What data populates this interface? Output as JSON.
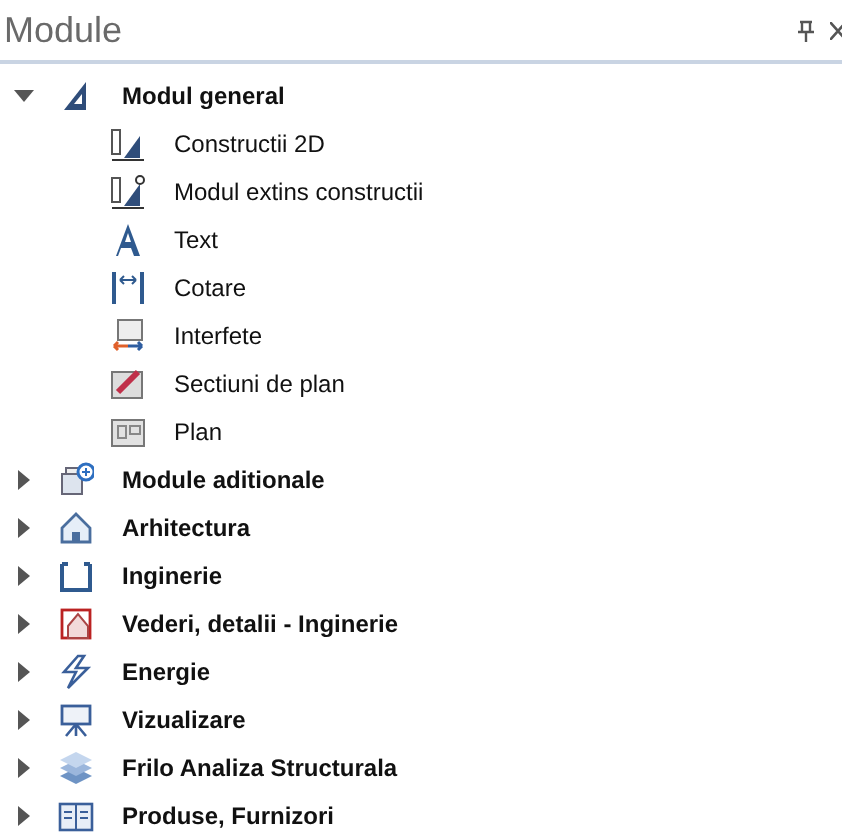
{
  "panel": {
    "title": "Module"
  },
  "tree": [
    {
      "label": "Modul general",
      "expanded": true,
      "children": [
        {
          "label": "Constructii 2D"
        },
        {
          "label": "Modul extins constructii"
        },
        {
          "label": "Text"
        },
        {
          "label": "Cotare"
        },
        {
          "label": "Interfete"
        },
        {
          "label": "Sectiuni de plan"
        },
        {
          "label": "Plan"
        }
      ]
    },
    {
      "label": "Module aditionale",
      "expanded": false
    },
    {
      "label": "Arhitectura",
      "expanded": false
    },
    {
      "label": "Inginerie",
      "expanded": false
    },
    {
      "label": "Vederi, detalii - Inginerie",
      "expanded": false
    },
    {
      "label": "Energie",
      "expanded": false
    },
    {
      "label": "Vizualizare",
      "expanded": false
    },
    {
      "label": "Frilo Analiza Structurala",
      "expanded": false
    },
    {
      "label": "Produse, Furnizori",
      "expanded": false
    }
  ]
}
